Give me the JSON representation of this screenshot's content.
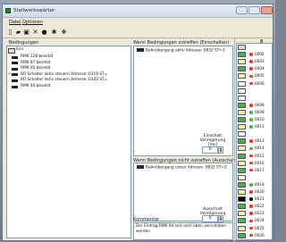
{
  "window": {
    "title": "Stellwerkswärter"
  },
  "menu": {
    "file": "Datei",
    "options": "Optionen"
  },
  "toolbar": {
    "icons": [
      "new-icon",
      "open-icon",
      "save-icon",
      "delete-icon",
      "print-icon",
      "settings-icon",
      "arrows-icon"
    ]
  },
  "left": {
    "header": "Bedingungen",
    "root": "Enn",
    "items": [
      {
        "label": "RMK 128 besetzt",
        "icon": "contact-icon",
        "checked": false
      },
      {
        "label": "RMK 87 besetzt",
        "icon": "contact-icon",
        "checked": false
      },
      {
        "label": "RMK 95 besetzt",
        "icon": "contact-icon",
        "checked": false
      },
      {
        "label": "BÜ Schalter aktiv steuern Adresse: 0319 ST=",
        "icon": "switch-icon",
        "checked": true
      },
      {
        "label": "BÜ Schalter aktiv steuern Adresse: 0320 ST=",
        "icon": "switch-icon",
        "checked": false
      },
      {
        "label": "RMK 94 besetzt",
        "icon": "contact-icon",
        "checked": false
      }
    ]
  },
  "on_section": {
    "header": "Wenn Bedingungen zutreffen (Einschalten)",
    "item": "Bahnübergang aktiv Adresse: 0832 ST=1",
    "delay_label": "Einschalt Verzögerung [ms]",
    "delay_value": "0"
  },
  "off_section": {
    "header": "Wenn Bedingungen nicht zutreffen (Ausschalten)",
    "item": "Bahnübergang unten Adresse: 0832 ST=2",
    "delay_label": "Ausschalt Verzögerung [ms]",
    "delay_value": "0"
  },
  "comment": {
    "header": "Kommentar",
    "text": "Der Eintrag RMK 94 soll nach oben verschoben werden"
  },
  "right_list": {
    "header": "Ⅲ",
    "rows": [
      {
        "swatch": "#d9d9d9",
        "dot": "",
        "num": ""
      },
      {
        "swatch": "#4caf50",
        "dot": "#e53935",
        "num": "0002"
      },
      {
        "swatch": "#f4f4a0",
        "dot": "#e53935",
        "num": "0003"
      },
      {
        "swatch": "#4caf50",
        "dot": "#e53935",
        "num": "0004"
      },
      {
        "swatch": "#f4f4a0",
        "dot": "#e53935",
        "num": "0005"
      },
      {
        "swatch": "#ffffff",
        "dot": "#e53935",
        "num": "0006"
      },
      {
        "swatch": "#ffffff",
        "dot": "",
        "num": ""
      },
      {
        "swatch": "#ffffff",
        "dot": "",
        "num": ""
      },
      {
        "swatch": "#4caf50",
        "dot": "#e53935",
        "num": "0008"
      },
      {
        "swatch": "#f4f4a0",
        "dot": "#4caf50",
        "num": "0009"
      },
      {
        "swatch": "#4caf50",
        "dot": "#4caf50",
        "num": "0010"
      },
      {
        "swatch": "#f4f4a0",
        "dot": "#4caf50",
        "num": "0011"
      },
      {
        "swatch": "#ffffff",
        "dot": "",
        "num": ""
      },
      {
        "swatch": "#4caf50",
        "dot": "#e53935",
        "num": "0013"
      },
      {
        "swatch": "#f4f4a0",
        "dot": "#4caf50",
        "num": "0014"
      },
      {
        "swatch": "#4caf50",
        "dot": "#e53935",
        "num": "0015"
      },
      {
        "swatch": "#f4f4a0",
        "dot": "#e53935",
        "num": "0016"
      },
      {
        "swatch": "#4caf50",
        "dot": "#e53935",
        "num": "0017"
      },
      {
        "swatch": "#ffffff",
        "dot": "",
        "num": ""
      },
      {
        "swatch": "#4caf50",
        "dot": "#4caf50",
        "num": "0019"
      },
      {
        "swatch": "#f4f4a0",
        "dot": "#e53935",
        "num": "0020"
      },
      {
        "swatch": "#000000",
        "dot": "#000000",
        "num": "0021"
      },
      {
        "swatch": "#4caf50",
        "dot": "#e53935",
        "num": "0022"
      },
      {
        "swatch": "#f4f4a0",
        "dot": "#e53935",
        "num": "0023"
      },
      {
        "swatch": "#4caf50",
        "dot": "#e53935",
        "num": "0024"
      },
      {
        "swatch": "#f4f4a0",
        "dot": "#e53935",
        "num": "0025"
      },
      {
        "swatch": "#4caf50",
        "dot": "#e53935",
        "num": "0026"
      }
    ]
  }
}
